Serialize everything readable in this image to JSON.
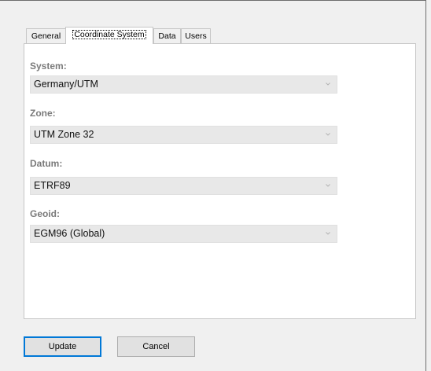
{
  "tabs": [
    {
      "label": "General",
      "active": false
    },
    {
      "label": "Coordinate System",
      "active": true
    },
    {
      "label": "Data",
      "active": false
    },
    {
      "label": "Users",
      "active": false
    }
  ],
  "fields": {
    "system": {
      "label": "System:",
      "value": "Germany/UTM"
    },
    "zone": {
      "label": "Zone:",
      "value": "UTM Zone 32"
    },
    "datum": {
      "label": "Datum:",
      "value": "ETRF89"
    },
    "geoid": {
      "label": "Geoid:",
      "value": "EGM96 (Global)"
    }
  },
  "buttons": {
    "update_label": "Update",
    "cancel_label": "Cancel"
  },
  "icons": {
    "dropdown_arrow": "chevron-down-icon"
  },
  "colors": {
    "focus_border": "#0078d7"
  }
}
